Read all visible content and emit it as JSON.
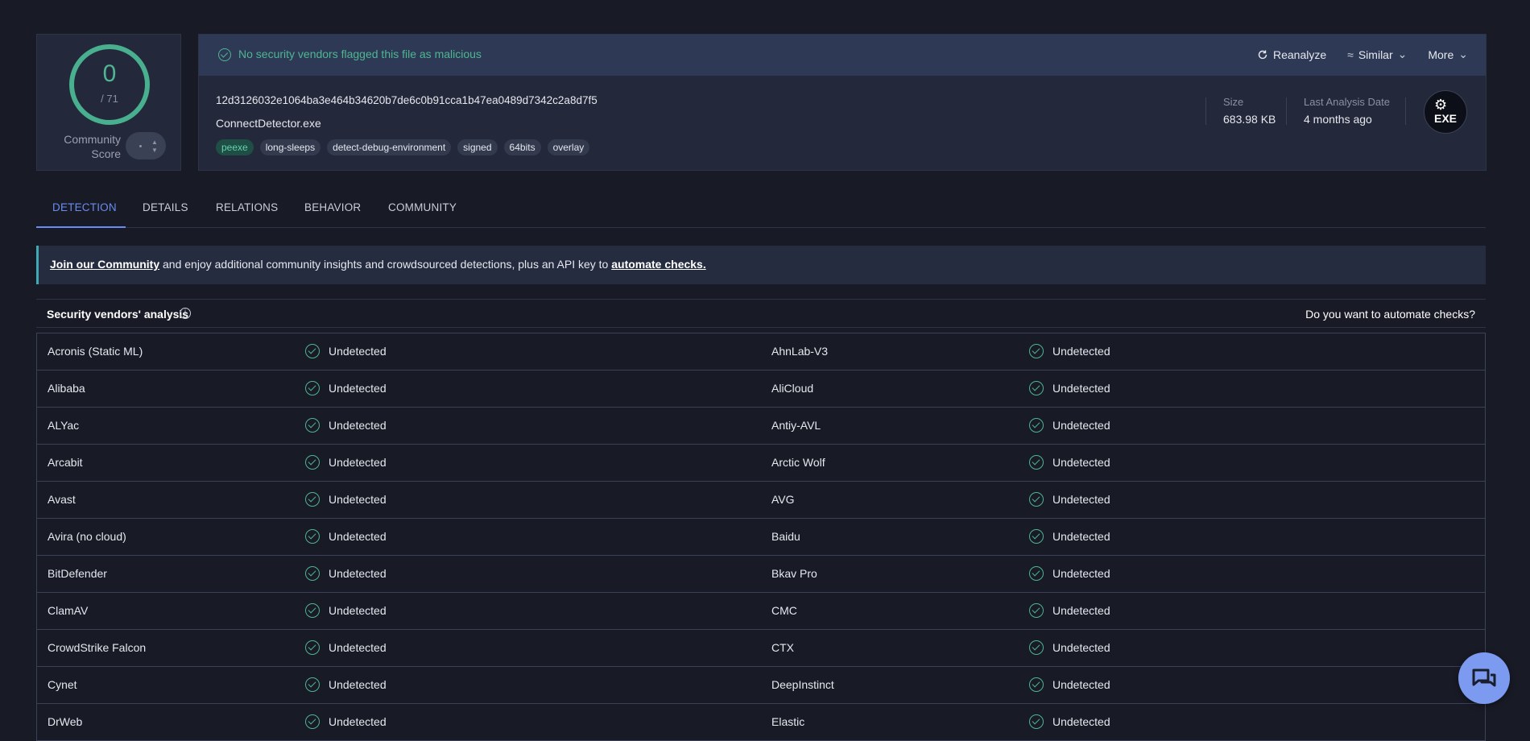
{
  "score": {
    "value": "0",
    "total": "/ 71",
    "community_label": "Community Score"
  },
  "file": {
    "banner_text": "No security vendors flagged this file as malicious",
    "actions": {
      "reanalyze": "Reanalyze",
      "similar": "Similar",
      "more": "More"
    },
    "hash": "12d3126032e1064ba3e464b34620b7de6c0b91cca1b47ea0489d7342c2a8d7f5",
    "name": "ConnectDetector.exe",
    "tags": [
      "peexe",
      "long-sleeps",
      "detect-debug-environment",
      "signed",
      "64bits",
      "overlay"
    ],
    "size_label": "Size",
    "size_value": "683.98 KB",
    "date_label": "Last Analysis Date",
    "date_value": "4 months ago",
    "type_badge": "EXE"
  },
  "tabs": [
    "DETECTION",
    "DETAILS",
    "RELATIONS",
    "BEHAVIOR",
    "COMMUNITY"
  ],
  "join_banner": {
    "link1": "Join our Community",
    "middle": " and enjoy additional community insights and crowdsourced detections, plus an API key to ",
    "link2": "automate checks."
  },
  "analysis": {
    "title": "Security vendors' analysis",
    "automate_question": "Do you want to automate checks?"
  },
  "vendors": [
    {
      "left": "Acronis (Static ML)",
      "left_status": "Undetected",
      "right": "AhnLab-V3",
      "right_status": "Undetected"
    },
    {
      "left": "Alibaba",
      "left_status": "Undetected",
      "right": "AliCloud",
      "right_status": "Undetected"
    },
    {
      "left": "ALYac",
      "left_status": "Undetected",
      "right": "Antiy-AVL",
      "right_status": "Undetected"
    },
    {
      "left": "Arcabit",
      "left_status": "Undetected",
      "right": "Arctic Wolf",
      "right_status": "Undetected"
    },
    {
      "left": "Avast",
      "left_status": "Undetected",
      "right": "AVG",
      "right_status": "Undetected"
    },
    {
      "left": "Avira (no cloud)",
      "left_status": "Undetected",
      "right": "Baidu",
      "right_status": "Undetected"
    },
    {
      "left": "BitDefender",
      "left_status": "Undetected",
      "right": "Bkav Pro",
      "right_status": "Undetected"
    },
    {
      "left": "ClamAV",
      "left_status": "Undetected",
      "right": "CMC",
      "right_status": "Undetected"
    },
    {
      "left": "CrowdStrike Falcon",
      "left_status": "Undetected",
      "right": "CTX",
      "right_status": "Undetected"
    },
    {
      "left": "Cynet",
      "left_status": "Undetected",
      "right": "DeepInstinct",
      "right_status": "Undetected"
    },
    {
      "left": "DrWeb",
      "left_status": "Undetected",
      "right": "Elastic",
      "right_status": "Undetected"
    }
  ],
  "colors": {
    "background": "#181a26",
    "card": "#23283a",
    "banner": "#2e3a55",
    "accent_green": "#4fb592",
    "accent_blue": "#6a8cf0",
    "chat_button": "#7c9bf0"
  },
  "icons": {
    "banner": "check-circle-icon",
    "reanalyze": "refresh-icon",
    "similar": "approx-icon",
    "dropdown": "chevron-down-icon",
    "info": "info-icon",
    "status": "check-circle-icon",
    "chat": "chat-icon",
    "file_type": "gear-icon"
  }
}
